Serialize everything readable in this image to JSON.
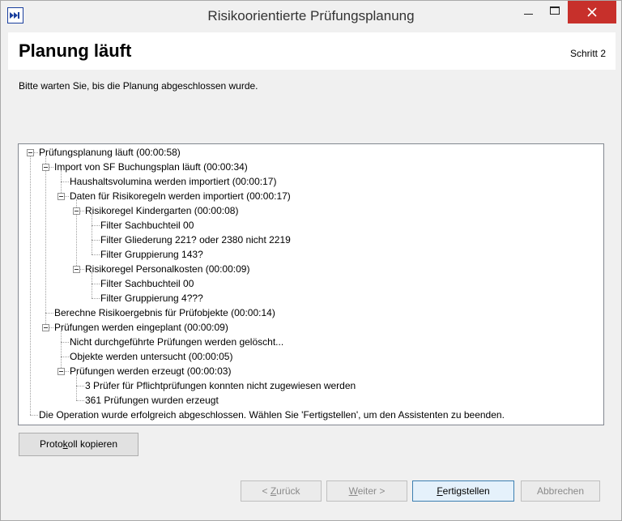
{
  "window": {
    "title": "Risikoorientierte Prüfungsplanung"
  },
  "icons": {
    "app": "forward-arrows-icon",
    "minimize": "minimize-icon",
    "maximize": "maximize-icon",
    "close": "close-icon",
    "collapse": "minus-box-icon"
  },
  "colors": {
    "close_button": "#c7302b",
    "primary_border": "#3c7fb1",
    "header_bg": "#ffffff"
  },
  "header": {
    "title": "Planung läuft",
    "step": "Schritt 2"
  },
  "instruction": "Bitte warten Sie, bis die Planung abgeschlossen wurde.",
  "tree": [
    {
      "text": "Prüfungsplanung läuft (00:00:58)",
      "level": 0,
      "expanded": true
    },
    {
      "text": "Import von SF Buchungsplan läuft (00:00:34)",
      "level": 1,
      "expanded": true
    },
    {
      "text": "Haushaltsvolumina werden importiert (00:00:17)",
      "level": 2
    },
    {
      "text": "Daten für Risikoregeln werden importiert (00:00:17)",
      "level": 2,
      "expanded": true
    },
    {
      "text": "Risikoregel Kindergarten (00:00:08)",
      "level": 3,
      "expanded": true
    },
    {
      "text": "Filter Sachbuchteil 00",
      "level": 4
    },
    {
      "text": "Filter Gliederung 221? oder 2380 nicht 2219",
      "level": 4
    },
    {
      "text": "Filter Gruppierung 143?",
      "level": 4
    },
    {
      "text": "Risikoregel Personalkosten (00:00:09)",
      "level": 3,
      "expanded": true
    },
    {
      "text": "Filter Sachbuchteil 00",
      "level": 4
    },
    {
      "text": "Filter Gruppierung 4???",
      "level": 4
    },
    {
      "text": "Berechne Risikoergebnis für Prüfobjekte (00:00:14)",
      "level": 1
    },
    {
      "text": "Prüfungen werden eingeplant (00:00:09)",
      "level": 1,
      "expanded": true
    },
    {
      "text": "Nicht durchgeführte Prüfungen werden gelöscht...",
      "level": 2
    },
    {
      "text": "Objekte werden untersucht (00:00:05)",
      "level": 2
    },
    {
      "text": "Prüfungen werden erzeugt (00:00:03)",
      "level": 2,
      "expanded": true
    },
    {
      "text": "3 Prüfer für Pflichtprüfungen konnten nicht zugewiesen werden",
      "level": 3
    },
    {
      "text": "361 Prüfungen wurden erzeugt",
      "level": 3
    },
    {
      "text": "Die Operation wurde erfolgreich abgeschlossen. Wählen Sie 'Fertigstellen', um den Assistenten zu beenden.",
      "level": 0
    }
  ],
  "buttons": {
    "copy": "Protokoll kopieren",
    "back": "< Zurück",
    "next": "Weiter >",
    "finish": "Fertigstellen",
    "cancel": "Abbrechen"
  }
}
